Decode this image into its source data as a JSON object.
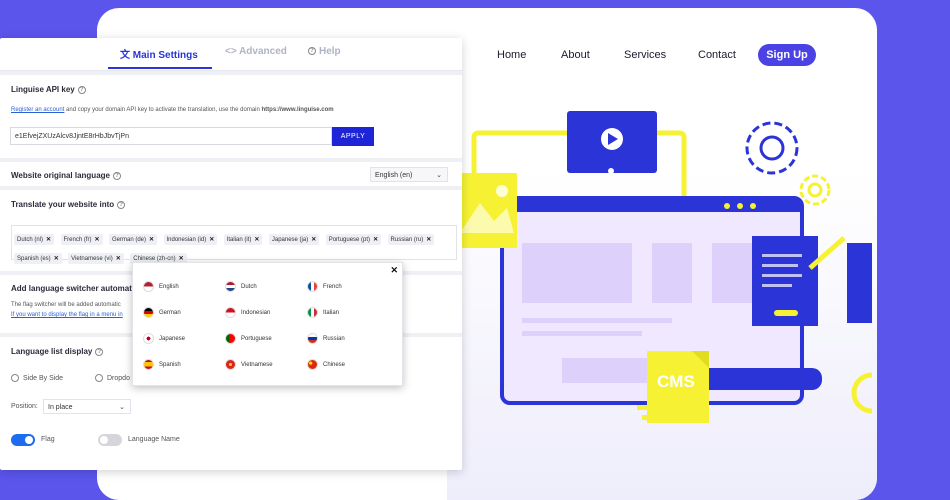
{
  "tabs": [
    {
      "label": "Main Settings"
    },
    {
      "label": "<> Advanced"
    },
    {
      "label": "Help"
    }
  ],
  "nav": {
    "home": "Home",
    "about": "About",
    "services": "Services",
    "contact": "Contact",
    "signup": "Sign Up"
  },
  "api": {
    "title": "Linguise API key",
    "link": "Register an account",
    "desc": "and copy your domain API key to activate the translation, use the domain",
    "domain": "https://www.linguise.com",
    "key": "e1EfvejZXUzAlcv8JjntE8rHbJbvTjPn",
    "apply": "APPLY"
  },
  "original": {
    "title": "Website original language",
    "value": "English (en)"
  },
  "translate": {
    "title": "Translate your website into",
    "chips": [
      "Dutch (nl)",
      "French (fr)",
      "German (de)",
      "Indonesian (id)",
      "Italian (it)",
      "Japanese (ja)",
      "Portuguese (pt)",
      "Russian (ru)",
      "Spanish (es)",
      "Vietnamese (vi)",
      "Chinese (zh-cn)"
    ]
  },
  "switcher": {
    "title": "Add language switcher automaticall",
    "desc": "The flag switcher will be added automatic",
    "link": "If you want to display the flag in a menu in"
  },
  "dropdown": {
    "languages": [
      "English",
      "Dutch",
      "French",
      "German",
      "Indonesian",
      "Italian",
      "Japanese",
      "Portuguese",
      "Russian",
      "Spanish",
      "Vietnamese",
      "Chinese"
    ]
  },
  "display": {
    "title": "Language list display",
    "side": "Side By Side",
    "drop": "Dropdo",
    "position_label": "Position:",
    "position_value": "In place",
    "flag": "Flag",
    "language_name": "Language Name"
  },
  "illustration": {
    "cms": "CMS"
  },
  "colors": {
    "accent": "#2b34d6",
    "brand": "#5b55ec",
    "yellow": "#f6f233"
  }
}
